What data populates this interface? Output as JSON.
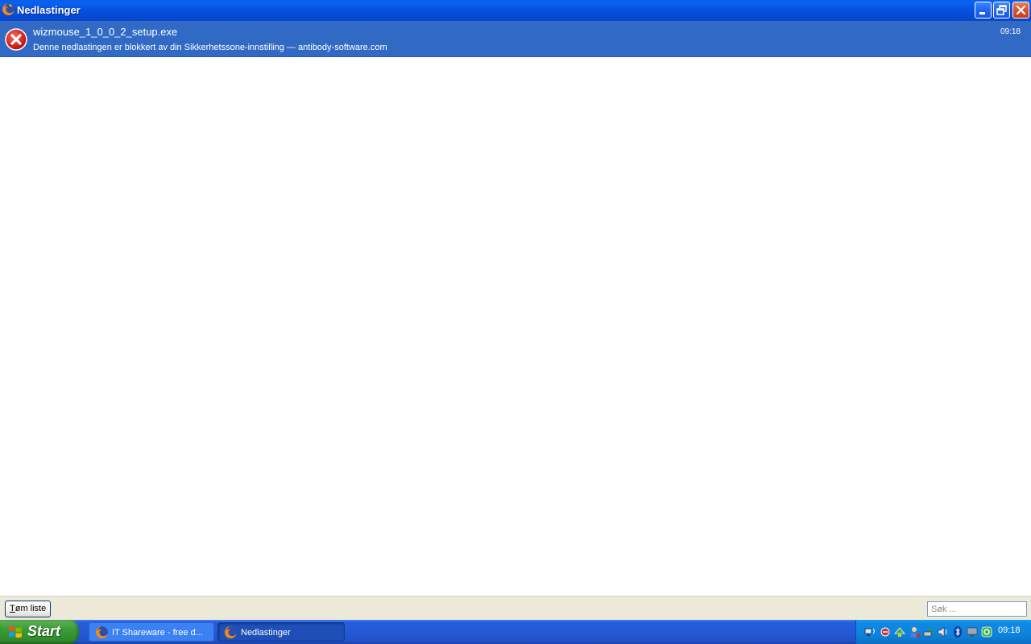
{
  "window": {
    "title": "Nedlastinger",
    "icon": "firefox-icon"
  },
  "downloads": [
    {
      "filename": "wizmouse_1_0_0_2_setup.exe",
      "status": "Denne nedlastingen er blokkert av din Sikkerhetssone-innstilling — antibody-software.com",
      "time": "09:18",
      "icon": "error-icon"
    }
  ],
  "bottom": {
    "clear_label_accel": "T",
    "clear_label_rest": "øm liste",
    "search_placeholder": "Søk ..."
  },
  "taskbar": {
    "start_label": "Start",
    "tasks": [
      {
        "label": "IT Shareware - free d...",
        "icon": "firefox-icon"
      },
      {
        "label": "Nedlastinger",
        "icon": "firefox-icon"
      }
    ],
    "clock": "09:18"
  },
  "colors": {
    "titlebar": "#0553e0",
    "selection": "#316ac5",
    "error_red": "#d9251d",
    "start_green": "#3c9a37"
  }
}
